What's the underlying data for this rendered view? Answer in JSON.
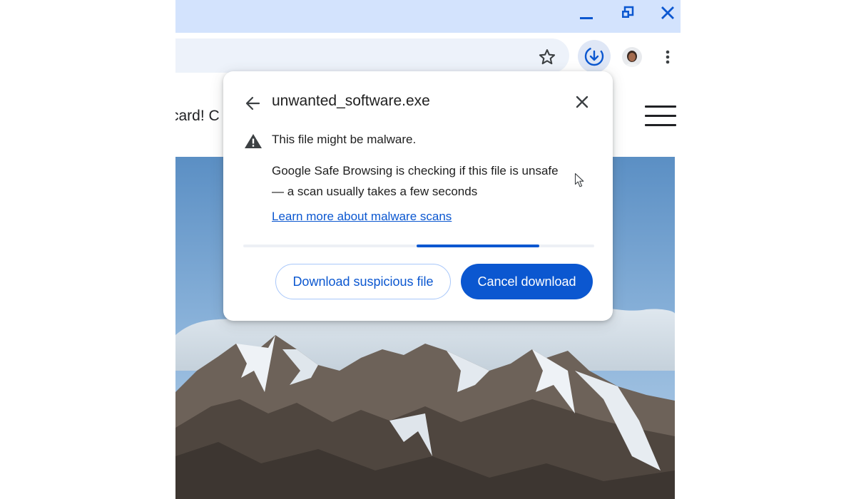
{
  "window": {
    "controls": {
      "minimize_icon": "minimize-icon",
      "restore_icon": "restore-icon",
      "close_icon": "close-icon"
    },
    "colors": {
      "titlebar": "#d3e3fd",
      "accent": "#0b57d0"
    }
  },
  "toolbar": {
    "bookmark_icon": "star-icon",
    "downloads_icon": "download-in-progress-icon",
    "profile_icon": "avatar",
    "menu_icon": "more-vert-icon"
  },
  "page": {
    "promo_text": "card! C",
    "menu_icon": "hamburger-icon"
  },
  "download_dialog": {
    "back_icon": "arrow-back-icon",
    "filename": "unwanted_software.exe",
    "close_icon": "close-icon",
    "warning_icon": "warning-triangle-icon",
    "warning_title": "This file might be malware.",
    "description": "Google Safe Browsing is checking if this file is unsafe — a scan usually takes a few seconds",
    "learn_more_link": "Learn more about malware scans",
    "scan_progress": 0.35,
    "download_button": "Download suspicious file",
    "cancel_button": "Cancel download"
  }
}
